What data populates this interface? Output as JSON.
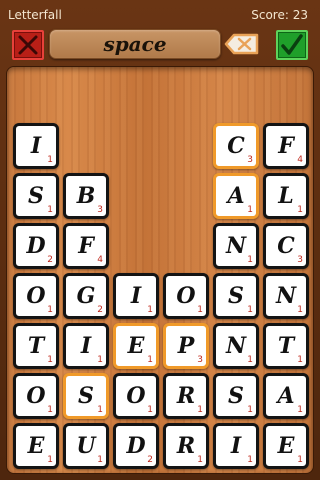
{
  "app": {
    "title": "Letterfall"
  },
  "score": {
    "text": "Score: 23"
  },
  "toolbar": {
    "word": "space"
  },
  "colors": {
    "clear_button": "#b81f17",
    "submit_button": "#1f9f2a",
    "selected_tile_border": "#f09a2a",
    "points": "#c0281c"
  },
  "icons": {
    "clear": "x-icon",
    "backspace": "backspace-icon",
    "submit": "checkmark-icon"
  },
  "grid": [
    [
      null,
      null,
      null,
      null,
      {
        "letter": "C",
        "points": "3",
        "selected": true
      },
      {
        "letter": "F",
        "points": "4"
      }
    ],
    [
      {
        "letter": "I",
        "points": "1"
      },
      null,
      null,
      null,
      null,
      null
    ],
    [
      {
        "letter": "S",
        "points": "1"
      },
      {
        "letter": "B",
        "points": "3"
      },
      null,
      null,
      {
        "letter": "A",
        "points": "1",
        "selected": true
      },
      {
        "letter": "L",
        "points": "1"
      }
    ],
    [
      {
        "letter": "D",
        "points": "2"
      },
      {
        "letter": "F",
        "points": "4"
      },
      null,
      null,
      {
        "letter": "N",
        "points": "1"
      },
      {
        "letter": "C",
        "points": "3"
      }
    ],
    [
      {
        "letter": "O",
        "points": "1"
      },
      {
        "letter": "G",
        "points": "2"
      },
      {
        "letter": "I",
        "points": "1"
      },
      {
        "letter": "O",
        "points": "1"
      },
      {
        "letter": "S",
        "points": "1"
      },
      {
        "letter": "N",
        "points": "1"
      }
    ],
    [
      {
        "letter": "T",
        "points": "1"
      },
      {
        "letter": "I",
        "points": "1"
      },
      {
        "letter": "E",
        "points": "1",
        "selected": true
      },
      {
        "letter": "P",
        "points": "3",
        "selected": true
      },
      {
        "letter": "N",
        "points": "1"
      },
      {
        "letter": "T",
        "points": "1"
      }
    ],
    [
      {
        "letter": "O",
        "points": "1"
      },
      {
        "letter": "S",
        "points": "1",
        "selected": true
      },
      {
        "letter": "O",
        "points": "1"
      },
      {
        "letter": "R",
        "points": "1"
      },
      {
        "letter": "S",
        "points": "1"
      },
      {
        "letter": "A",
        "points": "1"
      }
    ],
    [
      {
        "letter": "E",
        "points": "1"
      },
      {
        "letter": "U",
        "points": "1"
      },
      {
        "letter": "D",
        "points": "2"
      },
      {
        "letter": "R",
        "points": "1"
      },
      {
        "letter": "I",
        "points": "1"
      },
      {
        "letter": "E",
        "points": "1"
      }
    ]
  ]
}
